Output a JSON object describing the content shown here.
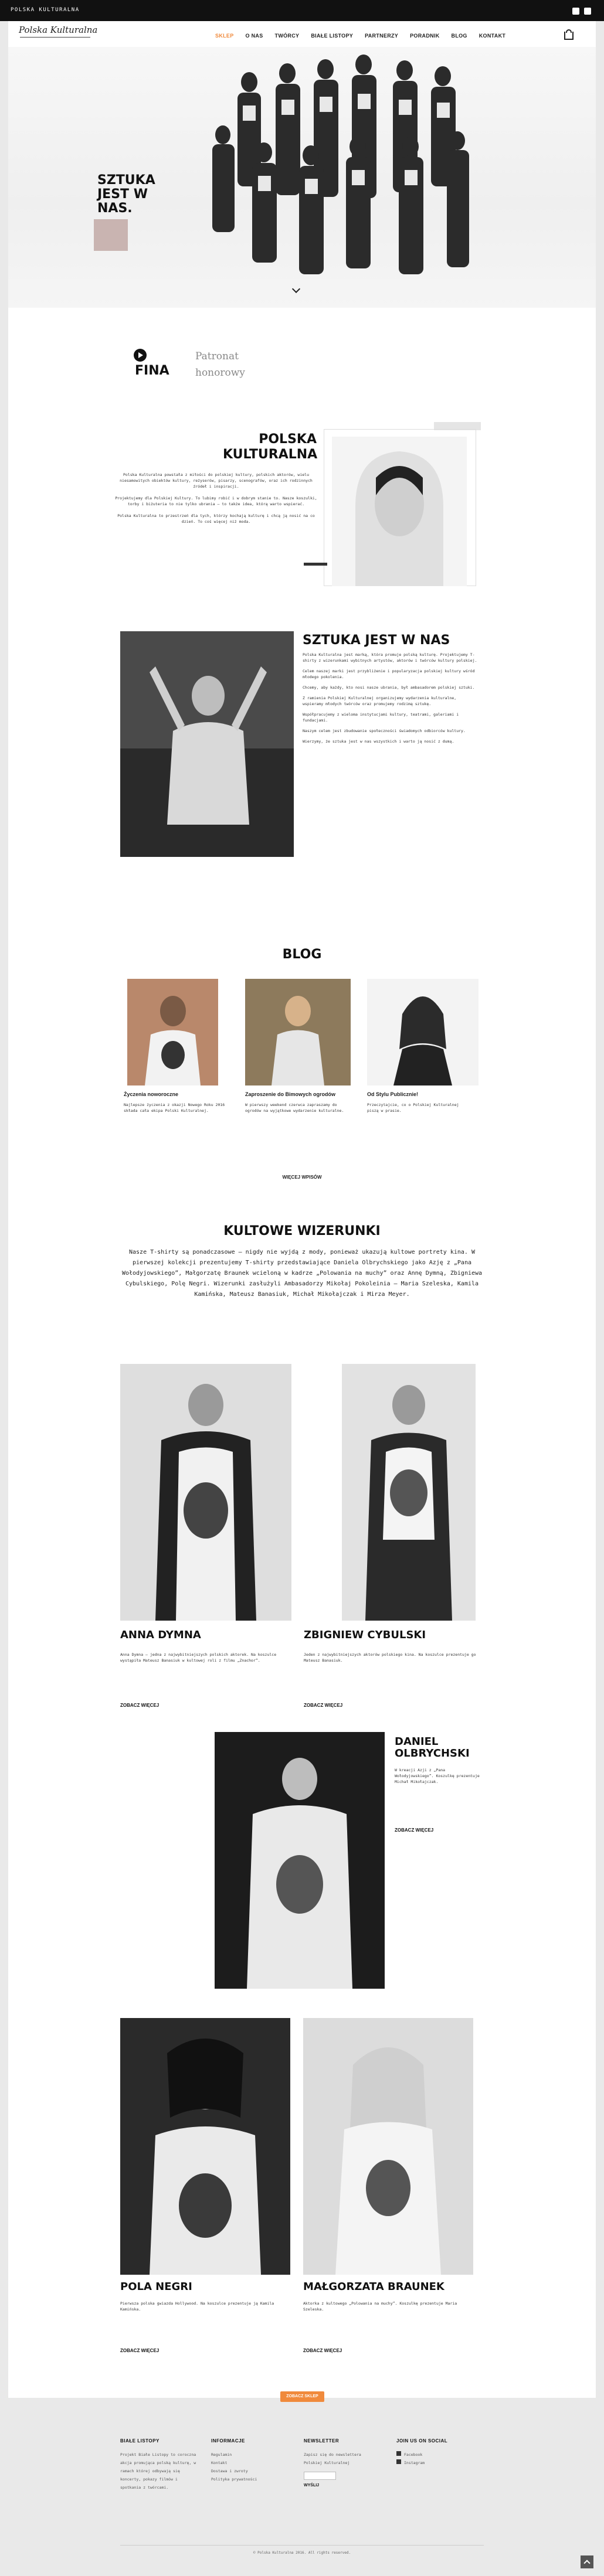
{
  "topbar": {
    "brand": "POLSKA KULTURALNA",
    "social": [
      "instagram-icon",
      "facebook-icon"
    ]
  },
  "header": {
    "logo": "Polska Kulturalna",
    "nav": [
      "SKLEP",
      "O NAS",
      "TWÓRCY",
      "BIAŁE LISTOPY",
      "PARTNERZY",
      "PORADNIK",
      "BLOG",
      "KONTAKT"
    ],
    "active": "SKLEP"
  },
  "hero": {
    "title": "SZTUKA JEST W NAS."
  },
  "patronat": {
    "logo": "FINA",
    "text": "Patronat honorowy"
  },
  "pk": {
    "title": "POLSKA KULTURALNA",
    "p1": "Polska Kulturalna powstała z miłości do polskiej kultury, polskich aktorów, wielu niesamowitych obiektów kultury, reżyserów, pisarzy, scenografów, oraz ich rodzinnych źródeł i inspiracji.",
    "p2": "Projektujemy dla Polskiej Kultury. To lubimy robić i w dobrym stanie to. Nasze koszulki, torby i biżuteria to nie tylko ubrania – to także idea, którą warto wspierać.",
    "p3": "Polska Kulturalna to przestrzeń dla tych, którzy kochają kulturę i chcą ją nosić na co dzień. To coś więcej niż moda."
  },
  "sztuka": {
    "title": "SZTUKA JEST W NAS",
    "paras": [
      "Polska Kulturalna jest marką, która promuje polską kulturę. Projektujemy T-shirty z wizerunkami wybitnych artystów, aktorów i twórców kultury polskiej.",
      "Celem naszej marki jest przybliżenie i popularyzacja polskiej kultury wśród młodego pokolenia.",
      "Chcemy, aby każdy, kto nosi nasze ubrania, był ambasadorem polskiej sztuki.",
      "Z ramienia Polskiej Kulturalnej organizujemy wydarzenia kulturalne, wspieramy młodych twórców oraz promujemy rodzimą sztukę.",
      "Współpracujemy z wieloma instytucjami kultury, teatrami, galeriami i fundacjami.",
      "Naszym celem jest zbudowanie społeczności świadomych odbiorców kultury.",
      "Wierzymy, że sztuka jest w nas wszystkich i warto ją nosić z dumą."
    ]
  },
  "blog": {
    "title": "BLOG",
    "posts": [
      {
        "title": "Życzenia noworoczne",
        "text": "Najlepsze życzenia z okazji Nowego Roku 2016 składa cała ekipa Polski Kulturalnej."
      },
      {
        "title": "Zaproszenie do Bimowych ogrodów",
        "text": "W pierwszy weekend czerwca zapraszamy do ogrodów na wyjątkowe wydarzenie kulturalne."
      },
      {
        "title": "Od Stylu Publicznie!",
        "text": "Przeczytajcie, co o Polskiej Kulturalnej piszą w prasie."
      }
    ],
    "more": "WIĘCEJ WPISÓW"
  },
  "kultowe": {
    "title": "KULTOWE WIZERUNKI",
    "intro": "Nasze T-shirty są ponadczasowe – nigdy nie wyjdą z mody, ponieważ ukazują kultowe portrety kina. W pierwszej kolekcji prezentujemy T-shirty przedstawiające Daniela Olbrychskiego jako Azję z „Pana Wołodyjowskiego”, Małgorzatę Braunek wcieloną w kadrze „Polowania na muchy” oraz Annę Dymną, Zbigniewa Cybulskiego, Polę Negri. Wizerunki zasłużyli Ambasadorzy Mikołaj Pokoleinia – Maria Szeleska, Kamila Kamińska, Mateusz Banasiuk, Michał Mikołajczak i Mirza Meyer.",
    "people": [
      {
        "name": "ANNA DYMNA",
        "desc": "Anna Dymna – jedna z najwybitniejszych polskich aktorek. Na koszulce wystąpiła Mateusz Banasiuk w kultowej roli z filmu „Znachor”."
      },
      {
        "name": "ZBIGNIEW CYBULSKI",
        "desc": "Jeden z najwybitniejszych aktorów polskiego kina. Na koszulce prezentuje go Mateusz Banasiuk."
      },
      {
        "name": "DANIEL OLBRYCHSKI",
        "desc": "W kreacji Azji z „Pana Wołodyjowskiego”. Koszulkę prezentuje Michał Mikołajczak."
      },
      {
        "name": "POLA NEGRI",
        "desc": "Pierwsza polska gwiazda Hollywood. Na koszulce prezentuje ją Kamila Kamińska."
      },
      {
        "name": "MAŁGORZATA BRAUNEK",
        "desc": "Aktorka z kultowego „Polowania na muchy”. Koszulkę prezentuje Maria Szeleska."
      }
    ],
    "more": "ZOBACZ WIĘCEJ",
    "shop_btn": "ZOBACZ SKLEP"
  },
  "footer": {
    "col1": {
      "title": "BIAŁE LISTOPY",
      "text": "Projekt Białe Listopy to coroczna akcja promująca polską kulturę, w ramach której odbywają się koncerty, pokazy filmów i spotkania z twórcami."
    },
    "col2": {
      "title": "INFORMACJE",
      "items": [
        "Regulamin",
        "Kontakt",
        "Dostawa i zwroty",
        "Polityka prywatności"
      ]
    },
    "col3": {
      "title": "NEWSLETTER",
      "text": "Zapisz się do newslettera Polskiej Kulturalnej",
      "send": "WYŚLIJ"
    },
    "col4": {
      "title": "JOIN US ON SOCIAL",
      "items": [
        "Facebook",
        "Instagram"
      ]
    },
    "copyright": "© Polska Kulturalna 2016. All rights reserved."
  },
  "colors": {
    "accent": "#f08a3c",
    "text": "#111111"
  }
}
